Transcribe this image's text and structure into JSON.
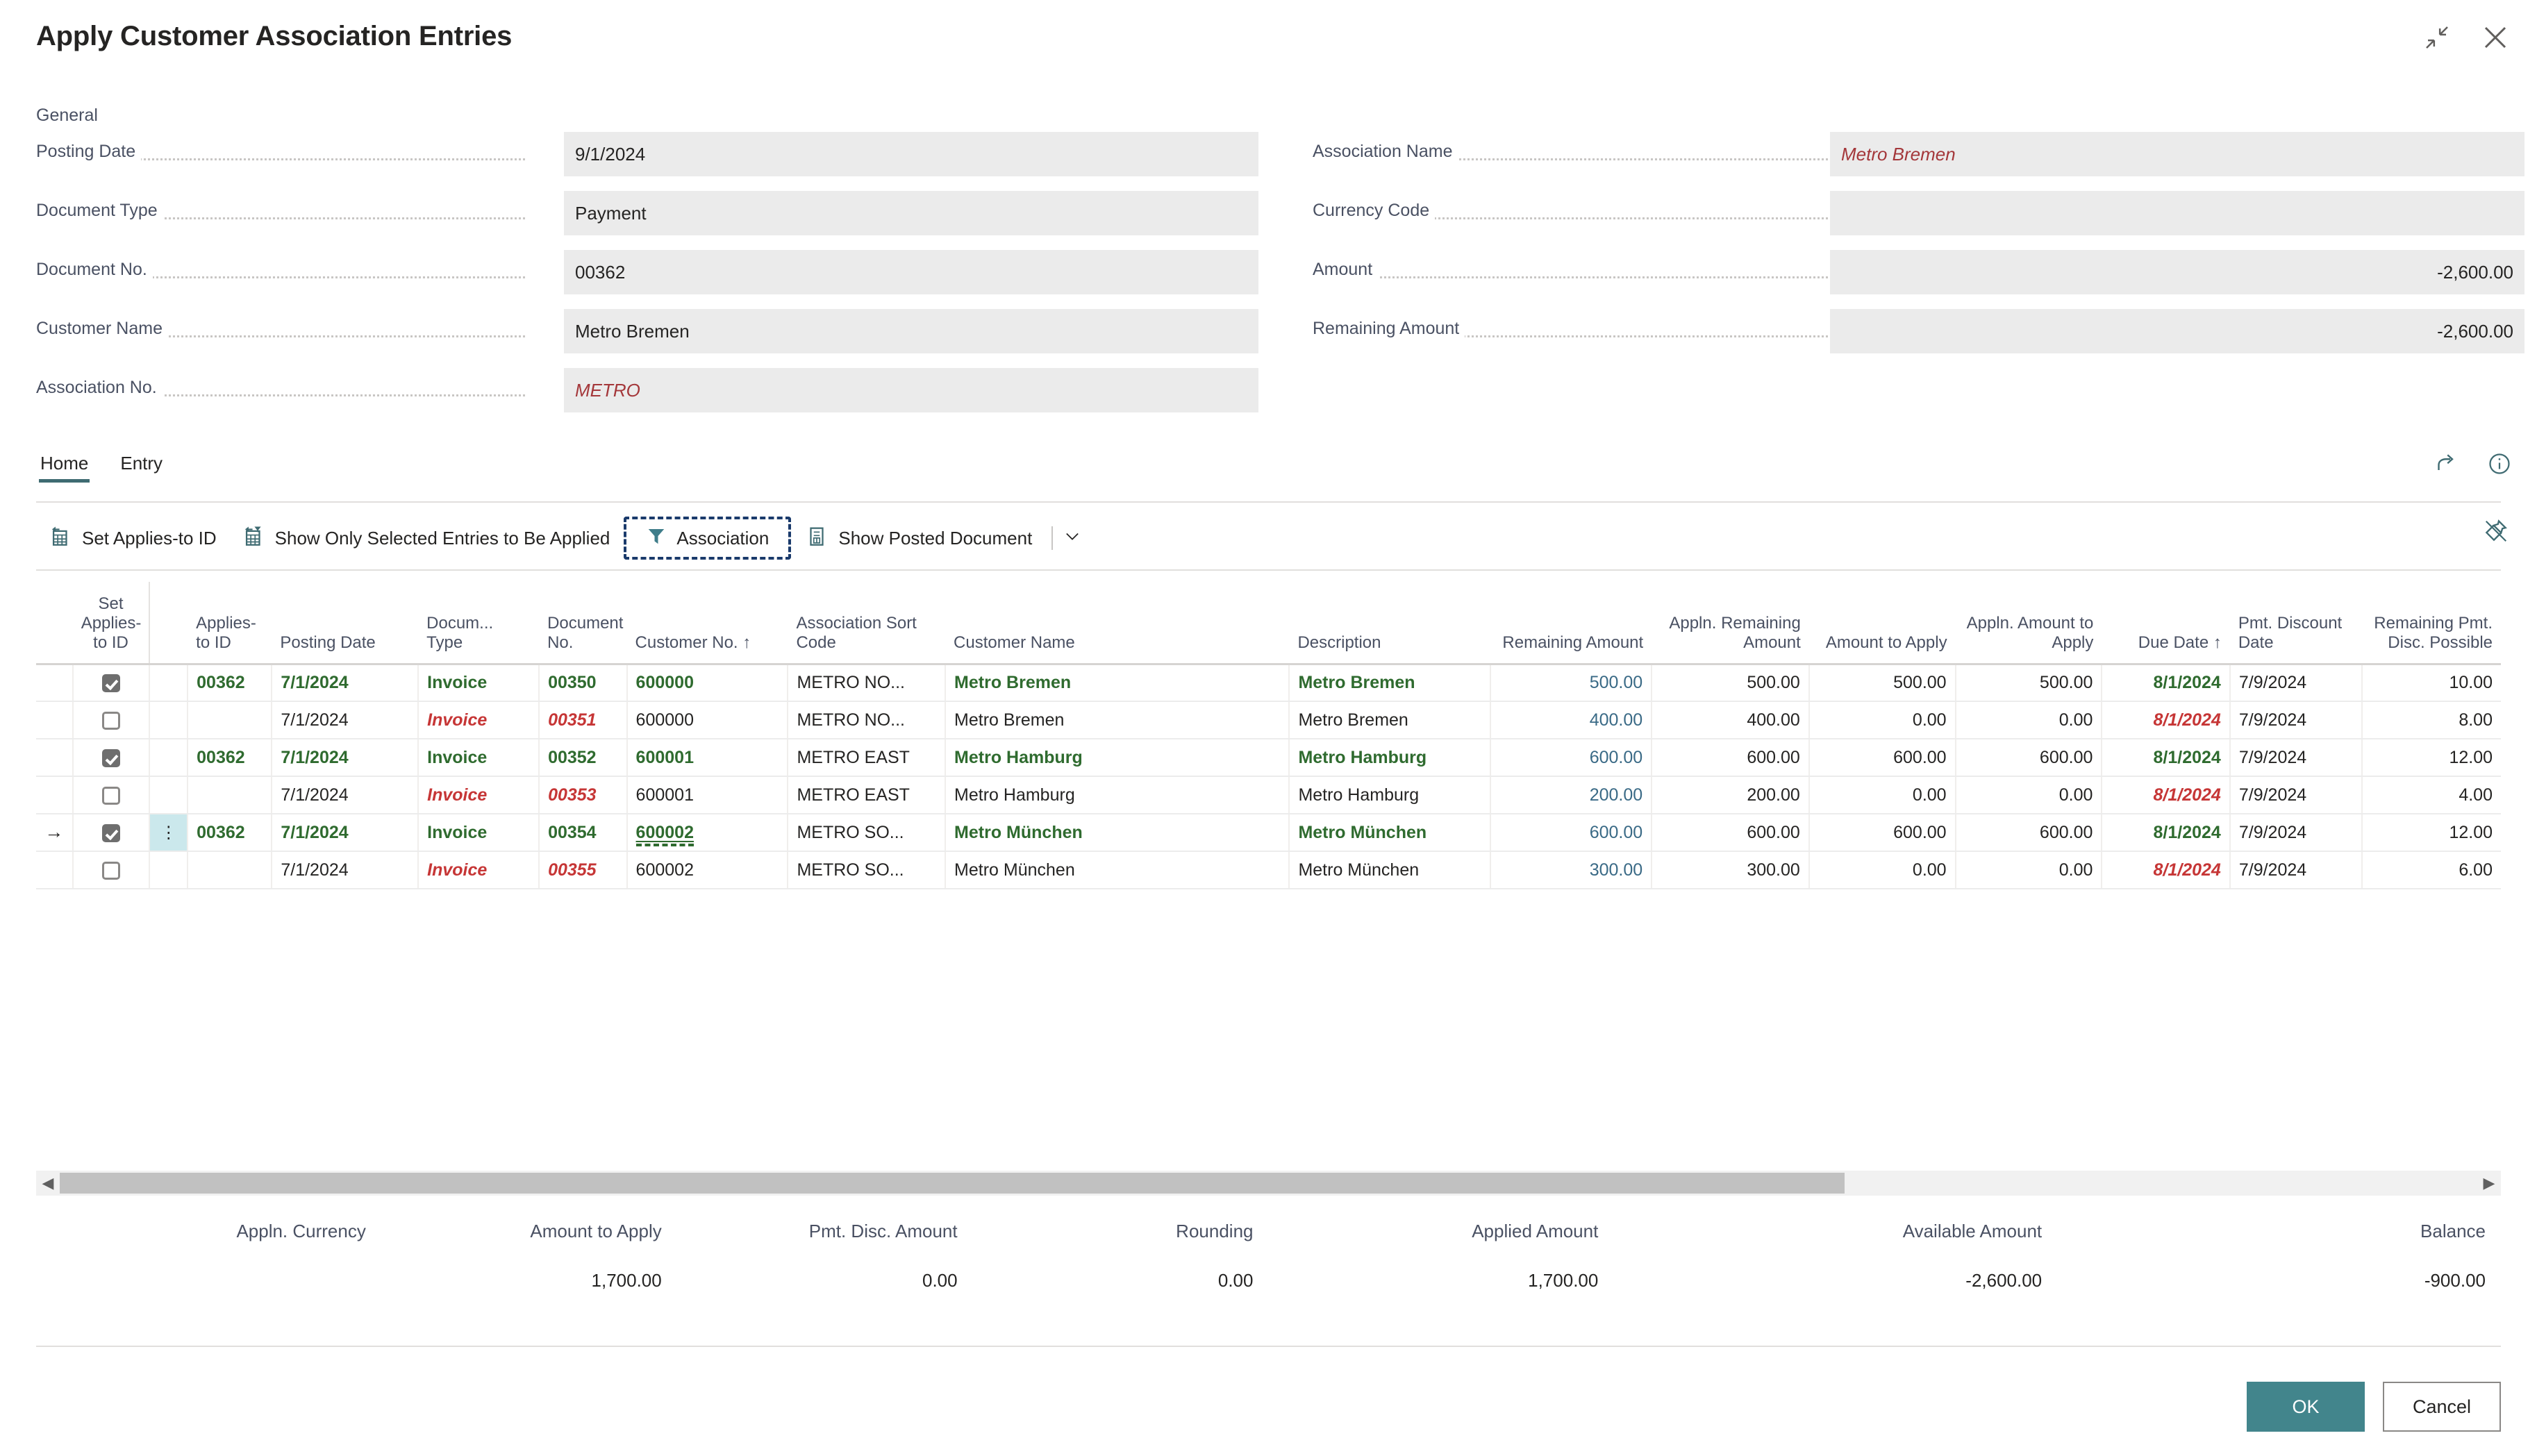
{
  "window": {
    "title": "Apply Customer Association Entries",
    "minimize_icon": "collapse-arrows-icon",
    "close_icon": "close-icon"
  },
  "general": {
    "section_label": "General",
    "left_fields": [
      {
        "label": "Posting Date",
        "value": "9/1/2024",
        "style": "text"
      },
      {
        "label": "Document Type",
        "value": "Payment",
        "style": "text"
      },
      {
        "label": "Document No.",
        "value": "00362",
        "style": "text"
      },
      {
        "label": "Customer Name",
        "value": "Metro Bremen",
        "style": "text"
      },
      {
        "label": "Association No.",
        "value": "METRO",
        "style": "assoc"
      }
    ],
    "right_fields": [
      {
        "label": "Association Name",
        "value": "Metro Bremen",
        "style": "assoc"
      },
      {
        "label": "Currency Code",
        "value": "",
        "style": "text"
      },
      {
        "label": "Amount",
        "value": "-2,600.00",
        "style": "num"
      },
      {
        "label": "Remaining Amount",
        "value": "-2,600.00",
        "style": "num"
      }
    ]
  },
  "ribbon": {
    "tabs": [
      {
        "label": "Home",
        "active": true
      },
      {
        "label": "Entry",
        "active": false
      }
    ],
    "actions": [
      {
        "label": "Set Applies-to ID",
        "icon": "set-applies-to-id-icon",
        "focused": false
      },
      {
        "label": "Show Only Selected Entries to Be Applied",
        "icon": "show-only-selected-icon",
        "focused": false
      },
      {
        "label": "Association",
        "icon": "filter-funnel-icon",
        "focused": true
      },
      {
        "label": "Show Posted Document",
        "icon": "document-icon",
        "focused": false
      }
    ],
    "split_caret": "chevron-down-icon",
    "right_icons": [
      {
        "name": "share-icon"
      },
      {
        "name": "info-icon"
      }
    ],
    "pin_icon": "unpin-icon"
  },
  "grid": {
    "columns": [
      {
        "key": "arrow",
        "label": "",
        "align": "c"
      },
      {
        "key": "set_applies_to_id",
        "label": "Set Applies-to ID",
        "align": "c"
      },
      {
        "key": "rowmenu",
        "label": "",
        "align": "c"
      },
      {
        "key": "applies_to_id",
        "label": "Applies-to ID",
        "align": "l"
      },
      {
        "key": "posting_date",
        "label": "Posting Date",
        "align": "l"
      },
      {
        "key": "document_type",
        "label": "Docum... Type",
        "align": "l"
      },
      {
        "key": "document_no",
        "label": "Document No.",
        "align": "l"
      },
      {
        "key": "customer_no",
        "label": "Customer No. ↑",
        "align": "l"
      },
      {
        "key": "association_sort_code",
        "label": "Association Sort Code",
        "align": "l"
      },
      {
        "key": "customer_name",
        "label": "Customer Name",
        "align": "l"
      },
      {
        "key": "description",
        "label": "Description",
        "align": "l"
      },
      {
        "key": "remaining_amount",
        "label": "Remaining Amount",
        "align": "r"
      },
      {
        "key": "appln_remaining_amount",
        "label": "Appln. Remaining Amount",
        "align": "r"
      },
      {
        "key": "amount_to_apply",
        "label": "Amount to Apply",
        "align": "r"
      },
      {
        "key": "appln_amount_to_apply",
        "label": "Appln. Amount to Apply",
        "align": "r"
      },
      {
        "key": "due_date",
        "label": "Due Date ↑",
        "align": "r"
      },
      {
        "key": "pmt_discount_date",
        "label": "Pmt. Discount Date",
        "align": "l"
      },
      {
        "key": "remaining_pmt_disc_possible",
        "label": "Remaining Pmt. Disc. Possible",
        "align": "r"
      }
    ],
    "rows": [
      {
        "selected_row": false,
        "checked": true,
        "applies_to_id": "00362",
        "posting_date": "7/1/2024",
        "document_type": "Invoice",
        "document_no": "00350",
        "customer_no": "600000",
        "association_sort_code": "METRO NO...",
        "customer_name": "Metro Bremen",
        "description": "Metro Bremen",
        "remaining_amount": "500.00",
        "appln_remaining_amount": "500.00",
        "amount_to_apply": "500.00",
        "appln_amount_to_apply": "500.00",
        "due_date": "8/1/2024",
        "pmt_discount_date": "7/9/2024",
        "remaining_pmt_disc_possible": "10.00",
        "emphasis": "applied"
      },
      {
        "selected_row": false,
        "checked": false,
        "applies_to_id": "",
        "posting_date": "7/1/2024",
        "document_type": "Invoice",
        "document_no": "00351",
        "customer_no": "600000",
        "association_sort_code": "METRO NO...",
        "customer_name": "Metro Bremen",
        "description": "Metro Bremen",
        "remaining_amount": "400.00",
        "appln_remaining_amount": "400.00",
        "amount_to_apply": "0.00",
        "appln_amount_to_apply": "0.00",
        "due_date": "8/1/2024",
        "pmt_discount_date": "7/9/2024",
        "remaining_pmt_disc_possible": "8.00",
        "emphasis": "open"
      },
      {
        "selected_row": false,
        "checked": true,
        "applies_to_id": "00362",
        "posting_date": "7/1/2024",
        "document_type": "Invoice",
        "document_no": "00352",
        "customer_no": "600001",
        "association_sort_code": "METRO EAST",
        "customer_name": "Metro Hamburg",
        "description": "Metro Hamburg",
        "remaining_amount": "600.00",
        "appln_remaining_amount": "600.00",
        "amount_to_apply": "600.00",
        "appln_amount_to_apply": "600.00",
        "due_date": "8/1/2024",
        "pmt_discount_date": "7/9/2024",
        "remaining_pmt_disc_possible": "12.00",
        "emphasis": "applied"
      },
      {
        "selected_row": false,
        "checked": false,
        "applies_to_id": "",
        "posting_date": "7/1/2024",
        "document_type": "Invoice",
        "document_no": "00353",
        "customer_no": "600001",
        "association_sort_code": "METRO EAST",
        "customer_name": "Metro Hamburg",
        "description": "Metro Hamburg",
        "remaining_amount": "200.00",
        "appln_remaining_amount": "200.00",
        "amount_to_apply": "0.00",
        "appln_amount_to_apply": "0.00",
        "due_date": "8/1/2024",
        "pmt_discount_date": "7/9/2024",
        "remaining_pmt_disc_possible": "4.00",
        "emphasis": "open"
      },
      {
        "selected_row": true,
        "checked": true,
        "applies_to_id": "00362",
        "posting_date": "7/1/2024",
        "document_type": "Invoice",
        "document_no": "00354",
        "customer_no": "600002",
        "association_sort_code": "METRO SO...",
        "customer_name": "Metro München",
        "description": "Metro München",
        "remaining_amount": "600.00",
        "appln_remaining_amount": "600.00",
        "amount_to_apply": "600.00",
        "appln_amount_to_apply": "600.00",
        "due_date": "8/1/2024",
        "pmt_discount_date": "7/9/2024",
        "remaining_pmt_disc_possible": "12.00",
        "emphasis": "applied"
      },
      {
        "selected_row": false,
        "checked": false,
        "applies_to_id": "",
        "posting_date": "7/1/2024",
        "document_type": "Invoice",
        "document_no": "00355",
        "customer_no": "600002",
        "association_sort_code": "METRO SO...",
        "customer_name": "Metro München",
        "description": "Metro München",
        "remaining_amount": "300.00",
        "appln_remaining_amount": "300.00",
        "amount_to_apply": "0.00",
        "appln_amount_to_apply": "0.00",
        "due_date": "8/1/2024",
        "pmt_discount_date": "7/9/2024",
        "remaining_pmt_disc_possible": "6.00",
        "emphasis": "open"
      }
    ]
  },
  "scrollbar": {
    "left_arrow": "chevron-left-icon",
    "right_arrow": "chevron-right-icon"
  },
  "totals": {
    "headers": [
      "Appln. Currency",
      "Amount to Apply",
      "Pmt. Disc. Amount",
      "Rounding",
      "Applied Amount",
      "Available Amount",
      "Balance"
    ],
    "values": [
      "",
      "1,700.00",
      "0.00",
      "0.00",
      "1,700.00",
      "-2,600.00",
      "-900.00"
    ]
  },
  "footer": {
    "ok_label": "OK",
    "cancel_label": "Cancel"
  },
  "colors": {
    "accent": "#42858c",
    "applied_green": "#2f6b2f",
    "open_red": "#c63636",
    "amount_teal": "#3a6a86",
    "focus_blue": "#1a3a6b",
    "selection_cyan": "#cbe8ec"
  }
}
